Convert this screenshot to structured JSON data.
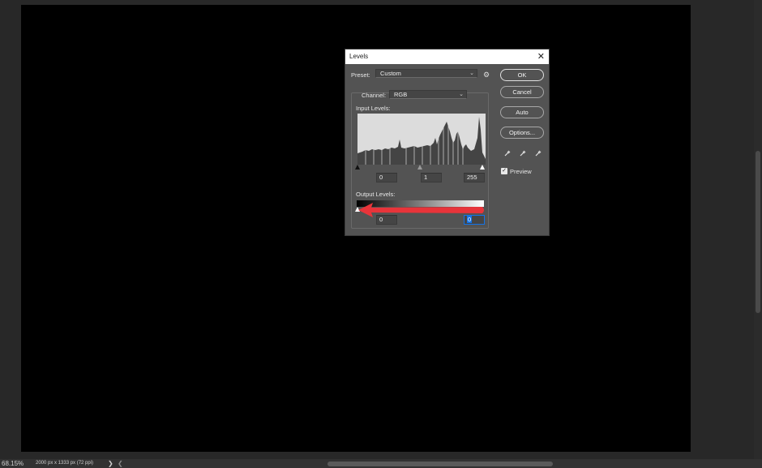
{
  "status": {
    "zoom": "68.15%",
    "doc_info": "2000 px x 1333 px (72 ppi)",
    "nav_right": "❯",
    "nav_left": "❮"
  },
  "dialog": {
    "title": "Levels",
    "close": "✕",
    "preset_label": "Preset:",
    "preset_value": "Custom",
    "channel_label": "Channel:",
    "channel_value": "RGB",
    "input_levels_label": "Input Levels:",
    "input_black": "0",
    "input_gamma": "1",
    "input_white": "255",
    "output_levels_label": "Output Levels:",
    "output_black": "0",
    "output_white": "0",
    "buttons": {
      "ok": "OK",
      "cancel": "Cancel",
      "auto": "Auto",
      "options": "Options..."
    },
    "preview_label": "Preview",
    "preview_checked": true
  },
  "colors": {
    "dialog_bg": "#535353",
    "canvas": "#000000",
    "annotation_arrow": "#e8343a",
    "selection": "#1473e6"
  }
}
